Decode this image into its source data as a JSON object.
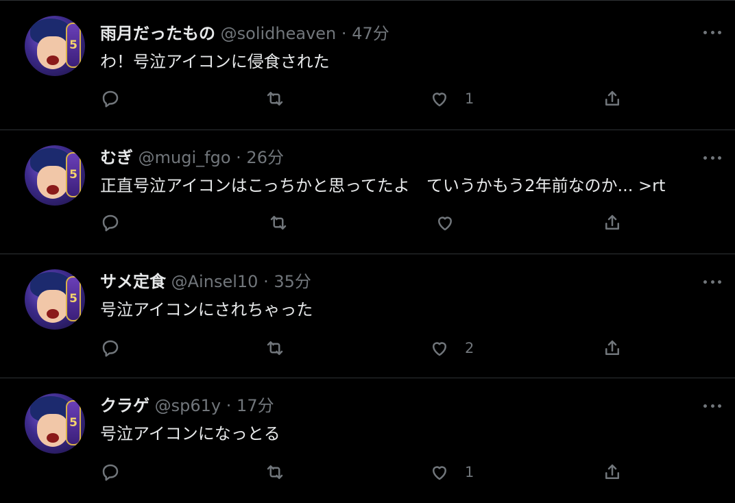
{
  "tweets": [
    {
      "name": "雨月だったもの",
      "handle": "@solidheaven",
      "separator": "·",
      "time": "47分",
      "text": "わ！号泣アイコンに侵食された",
      "likes": "1",
      "avatar_badge": "5"
    },
    {
      "name": "むぎ",
      "handle": "@mugi_fgo",
      "separator": "·",
      "time": "26分",
      "text": "正直号泣アイコンはこっちかと思ってたよ　ていうかもう2年前なのか... >rt",
      "likes": "",
      "avatar_badge": "5"
    },
    {
      "name": "サメ定食",
      "handle": "@Ainsel10",
      "separator": "·",
      "time": "35分",
      "text": "号泣アイコンにされちゃった",
      "likes": "2",
      "avatar_badge": "5"
    },
    {
      "name": "クラゲ",
      "handle": "@sp61y",
      "separator": "·",
      "time": "17分",
      "text": "号泣アイコンになっとる",
      "likes": "1",
      "avatar_badge": "5"
    }
  ],
  "icons": {
    "reply": "reply-icon",
    "retweet": "retweet-icon",
    "like": "heart-icon",
    "share": "share-icon",
    "more": "more-icon"
  },
  "colors": {
    "background": "#000000",
    "text": "#e7e9ea",
    "secondary": "#71767b",
    "border": "#2f3336"
  }
}
